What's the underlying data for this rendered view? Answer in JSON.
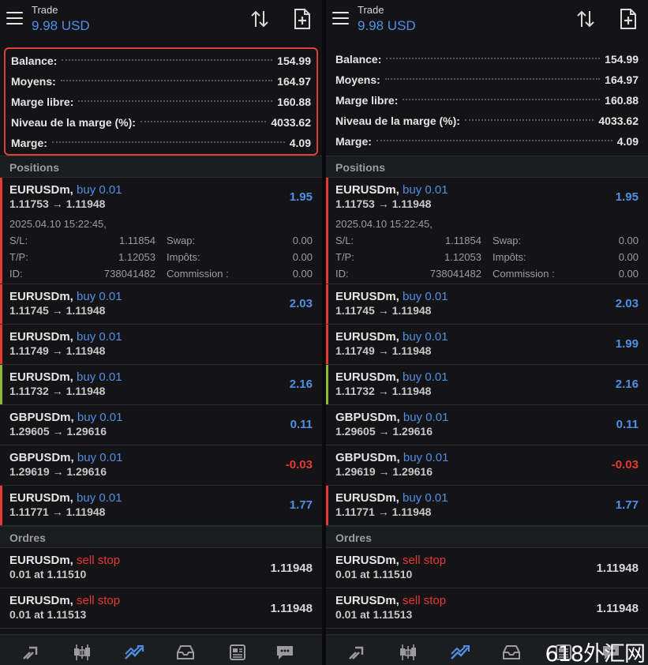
{
  "colors": {
    "accent": "#4f8fe6",
    "loss": "#e53935",
    "highlight_border": "#e0403a",
    "green_bar": "#8ab82e"
  },
  "header": {
    "title": "Trade",
    "value": "9.98 USD"
  },
  "summary": [
    {
      "label": "Balance:",
      "value": "154.99"
    },
    {
      "label": "Moyens:",
      "value": "164.97"
    },
    {
      "label": "Marge libre:",
      "value": "160.88"
    },
    {
      "label": "Niveau de la marge (%):",
      "value": "4033.62"
    },
    {
      "label": "Marge:",
      "value": "4.09"
    }
  ],
  "sections": {
    "positions": "Positions",
    "orders": "Ordres"
  },
  "detail_labels": {
    "sl": "S/L:",
    "tp": "T/P:",
    "id": "ID:",
    "swap": "Swap:",
    "taxes": "Impôts:",
    "commission": "Commission :"
  },
  "left": {
    "positions": [
      {
        "symbol": "EURUSDm,",
        "side": "buy 0.01",
        "prices": "1.11753 → 1.11948",
        "profit": "1.95",
        "bar": "red",
        "details": {
          "time": "2025.04.10 15:22:45,",
          "sl": "1.11854",
          "tp": "1.12053",
          "id": "738041482",
          "swap": "0.00",
          "taxes": "0.00",
          "commission": "0.00"
        }
      },
      {
        "symbol": "EURUSDm,",
        "side": "buy 0.01",
        "prices": "1.11745 → 1.11948",
        "profit": "2.03",
        "bar": "red"
      },
      {
        "symbol": "EURUSDm,",
        "side": "buy 0.01",
        "prices": "1.11749 → 1.11948",
        "profit": "",
        "bar": "red"
      },
      {
        "symbol": "EURUSDm,",
        "side": "buy 0.01",
        "prices": "1.11732 → 1.11948",
        "profit": "2.16",
        "bar": "green"
      },
      {
        "symbol": "GBPUSDm,",
        "side": "buy 0.01",
        "prices": "1.29605 → 1.29616",
        "profit": "0.11",
        "bar": "none"
      },
      {
        "symbol": "GBPUSDm,",
        "side": "buy 0.01",
        "prices": "1.29619 → 1.29616",
        "profit": "-0.03",
        "bar": "none"
      },
      {
        "symbol": "EURUSDm,",
        "side": "buy 0.01",
        "prices": "1.11771 → 1.11948",
        "profit": "1.77",
        "bar": "red"
      }
    ],
    "orders": [
      {
        "symbol": "EURUSDm,",
        "side": "sell stop",
        "detail": "0.01 at 1.11510",
        "price": "1.11948"
      },
      {
        "symbol": "EURUSDm,",
        "side": "sell stop",
        "detail": "0.01 at 1.11513",
        "price": "1.11948"
      }
    ]
  },
  "right": {
    "positions": [
      {
        "symbol": "EURUSDm,",
        "side": "buy 0.01",
        "prices": "1.11753 → 1.11948",
        "profit": "1.95",
        "bar": "red",
        "details": {
          "time": "2025.04.10 15:22:45,",
          "sl": "1.11854",
          "tp": "1.12053",
          "id": "738041482",
          "swap": "0.00",
          "taxes": "0.00",
          "commission": "0.00"
        }
      },
      {
        "symbol": "EURUSDm,",
        "side": "buy 0.01",
        "prices": "1.11745 → 1.11948",
        "profit": "2.03",
        "bar": "red"
      },
      {
        "symbol": "EURUSDm,",
        "side": "buy 0.01",
        "prices": "1.11749 → 1.11948",
        "profit": "1.99",
        "bar": "red"
      },
      {
        "symbol": "EURUSDm,",
        "side": "buy 0.01",
        "prices": "1.11732 → 1.11948",
        "profit": "2.16",
        "bar": "green"
      },
      {
        "symbol": "GBPUSDm,",
        "side": "buy 0.01",
        "prices": "1.29605 → 1.29616",
        "profit": "0.11",
        "bar": "none"
      },
      {
        "symbol": "GBPUSDm,",
        "side": "buy 0.01",
        "prices": "1.29619 → 1.29616",
        "profit": "-0.03",
        "bar": "none"
      },
      {
        "symbol": "EURUSDm,",
        "side": "buy 0.01",
        "prices": "1.11771 → 1.11948",
        "profit": "1.77",
        "bar": "red"
      }
    ],
    "orders": [
      {
        "symbol": "EURUSDm,",
        "side": "sell stop",
        "detail": "0.01 at 1.11510",
        "price": "1.11948"
      },
      {
        "symbol": "EURUSDm,",
        "side": "sell stop",
        "detail": "0.01 at 1.11513",
        "price": "1.11948"
      }
    ]
  },
  "nav_icons": [
    "quotes-icon",
    "chart-icon",
    "trade-icon",
    "history-icon",
    "news-icon",
    "chat-icon"
  ],
  "watermark": "618外汇网"
}
